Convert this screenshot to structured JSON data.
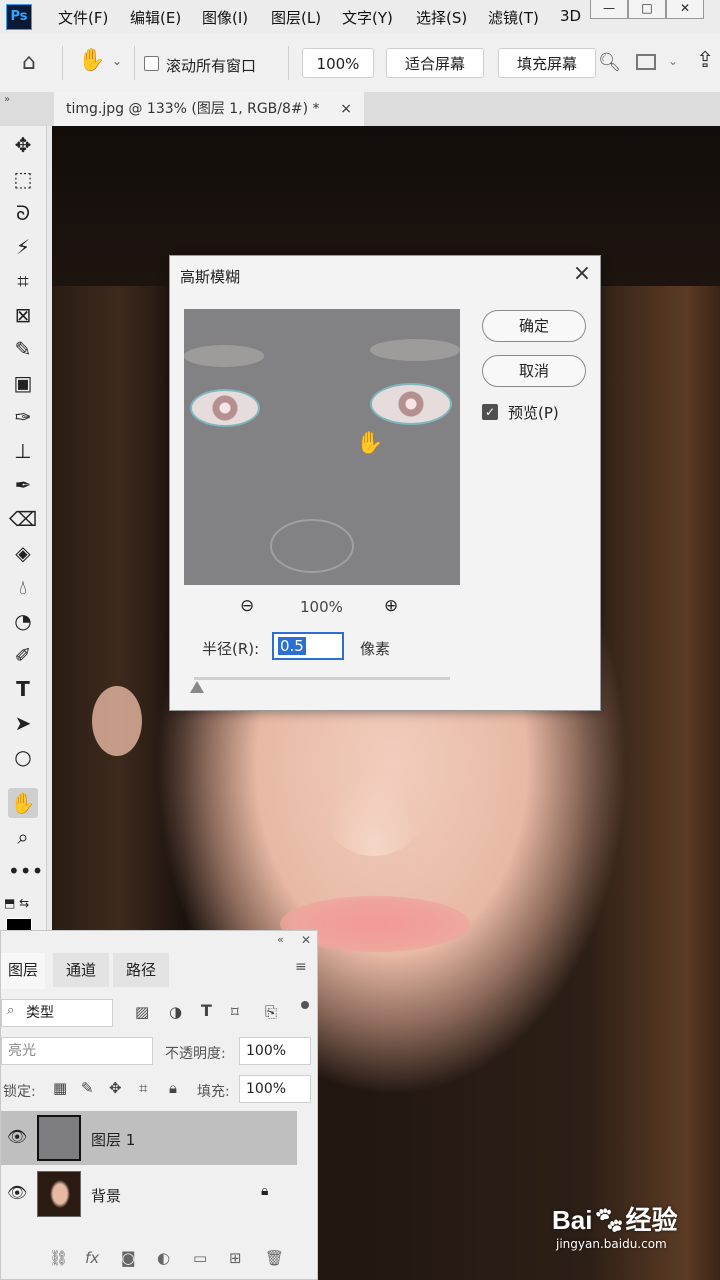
{
  "menu": {
    "logo": "Ps",
    "items": [
      "文件(F)",
      "编辑(E)",
      "图像(I)",
      "图层(L)",
      "文字(Y)",
      "选择(S)",
      "滤镜(T)",
      "3D"
    ]
  },
  "options": {
    "scroll_all_label": "滚动所有窗口",
    "zoom_value": "100%",
    "fit_screen": "适合屏幕",
    "fill_screen": "填充屏幕"
  },
  "document": {
    "tab_title": "timg.jpg @ 133% (图层 1, RGB/8#) *",
    "tab_close": "×"
  },
  "dialog": {
    "title": "高斯模糊",
    "close": "×",
    "ok": "确定",
    "cancel": "取消",
    "preview_label": "预览(P)",
    "preview_checked": true,
    "preview_zoom": "100%",
    "radius_label": "半径(R):",
    "radius_value": "0.5",
    "radius_unit": "像素",
    "slider_level": 0.0
  },
  "layers_panel": {
    "tabs": [
      "图层",
      "通道",
      "路径"
    ],
    "filter_label": "类型",
    "blend_mode": "亮光",
    "opacity_label": "不透明度:",
    "opacity_value": "100%",
    "lock_label": "锁定:",
    "fill_label": "填充:",
    "fill_value": "100%",
    "layers": [
      {
        "name": "图层 1",
        "selected": true,
        "visible": true,
        "locked": false
      },
      {
        "name": "背景",
        "selected": false,
        "visible": true,
        "locked": true
      }
    ]
  },
  "watermark": {
    "brand": "Bai",
    "brand_suffix": "经验",
    "url": "jingyan.baidu.com"
  }
}
